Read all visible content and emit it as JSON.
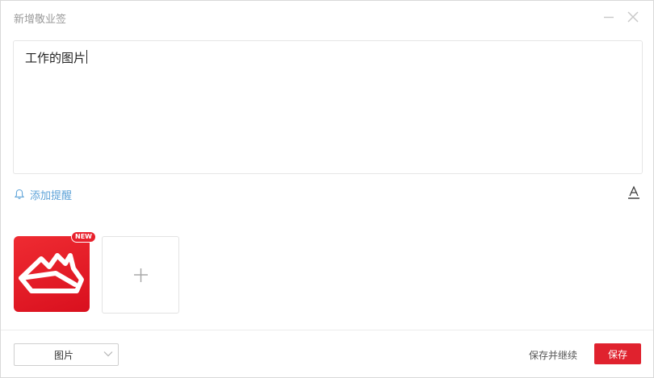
{
  "window": {
    "title": "新增敬业签",
    "icons": {
      "minimize": "minimize-icon",
      "close": "close-icon"
    }
  },
  "editor": {
    "content": "工作的图片"
  },
  "toolbar": {
    "reminder_label": "添加提醒",
    "reminder_icon": "bell-icon",
    "font_icon": "font-style-icon"
  },
  "attachments": {
    "items": [
      {
        "icon": "app-logo-icon",
        "badge": "NEW"
      }
    ],
    "add_icon": "plus-icon"
  },
  "footer": {
    "type_select": {
      "value": "图片"
    },
    "save_continue_label": "保存并继续",
    "save_label": "保存"
  },
  "colors": {
    "accent": "#e0222e",
    "link": "#5ea3d8",
    "thumb_bg": "#ef2b32"
  }
}
